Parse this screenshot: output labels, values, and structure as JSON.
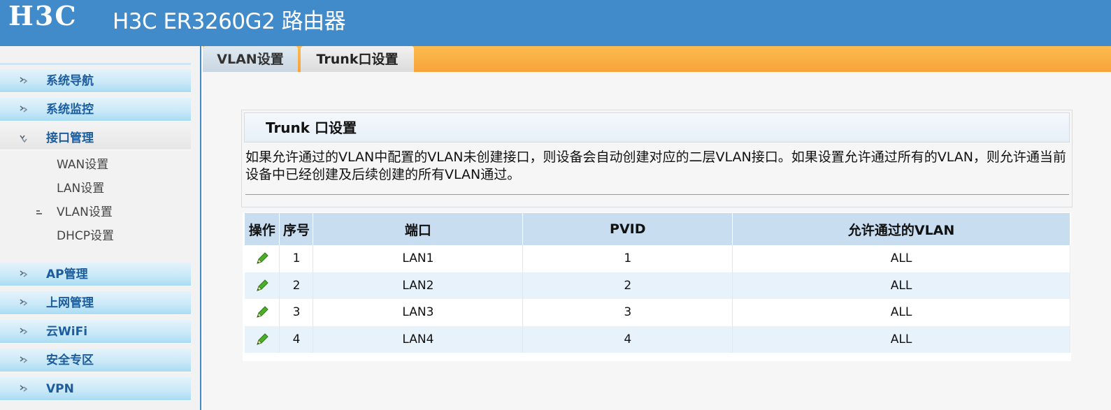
{
  "header": {
    "logo": "H3C",
    "title": "H3C ER3260G2 路由器"
  },
  "sidebar": {
    "menu": [
      {
        "label": "系统导航",
        "state": "collapsed"
      },
      {
        "label": "系统监控",
        "state": "collapsed"
      },
      {
        "label": "接口管理",
        "state": "expanded"
      },
      {
        "label": "AP管理",
        "state": "collapsed"
      },
      {
        "label": "上网管理",
        "state": "collapsed"
      },
      {
        "label": "云WiFi",
        "state": "collapsed"
      },
      {
        "label": "安全专区",
        "state": "collapsed"
      },
      {
        "label": "VPN",
        "state": "collapsed"
      }
    ],
    "submenu": [
      {
        "label": "WAN设置"
      },
      {
        "label": "LAN设置"
      },
      {
        "label": "VLAN设置",
        "active": true
      },
      {
        "label": "DHCP设置"
      }
    ]
  },
  "tabs": [
    {
      "label": "VLAN设置",
      "active": false
    },
    {
      "label": "Trunk口设置",
      "active": true
    }
  ],
  "info": {
    "title": "Trunk 口设置",
    "text": "如果允许通过的VLAN中配置的VLAN未创建接口，则设备会自动创建对应的二层VLAN接口。如果设置允许通过所有的VLAN，则允许通当前设备中已经创建及后续创建的所有VLAN通过。"
  },
  "table": {
    "headers": [
      "操作",
      "序号",
      "端口",
      "PVID",
      "允许通过的VLAN"
    ],
    "rows": [
      {
        "index": "1",
        "port": "LAN1",
        "pvid": "1",
        "vlan": "ALL"
      },
      {
        "index": "2",
        "port": "LAN2",
        "pvid": "2",
        "vlan": "ALL"
      },
      {
        "index": "3",
        "port": "LAN3",
        "pvid": "3",
        "vlan": "ALL"
      },
      {
        "index": "4",
        "port": "LAN4",
        "pvid": "4",
        "vlan": "ALL"
      }
    ],
    "action_icon": "edit-pencil-icon"
  },
  "colors": {
    "header_bg": "#418bcb",
    "tabbar": "#f6a33b",
    "menu_label": "#1b5d9e",
    "table_header": "#c9ddf0"
  }
}
